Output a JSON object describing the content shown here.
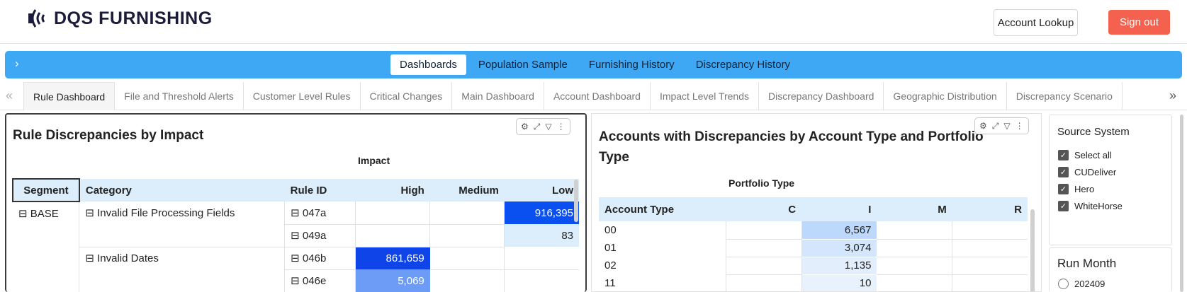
{
  "brand": {
    "name": "DQS FURNISHING"
  },
  "header": {
    "lookup_label": "Account Lookup",
    "signout_label": "Sign out"
  },
  "nav": {
    "items": [
      {
        "label": "Dashboards",
        "active": true
      },
      {
        "label": "Population Sample",
        "active": false
      },
      {
        "label": "Furnishing History",
        "active": false
      },
      {
        "label": "Discrepancy History",
        "active": false
      }
    ]
  },
  "tabs": [
    "Rule Dashboard",
    "File and Threshold Alerts",
    "Customer Level Rules",
    "Critical Changes",
    "Main Dashboard",
    "Account Dashboard",
    "Impact Level Trends",
    "Discrepancy Dashboard",
    "Geographic Distribution",
    "Discrepancy Scenario"
  ],
  "rule_panel": {
    "title": "Rule Discrepancies by Impact",
    "column_group": "Impact",
    "headers": [
      "Segment",
      "Category",
      "Rule ID",
      "High",
      "Medium",
      "Low"
    ],
    "segment": "BASE",
    "categories": [
      "Invalid File Processing Fields",
      "Invalid Dates"
    ],
    "rules": [
      {
        "id": "047a",
        "high": "",
        "medium": "",
        "low": "916,395"
      },
      {
        "id": "049a",
        "high": "",
        "medium": "",
        "low": "83"
      },
      {
        "id": "046b",
        "high": "861,659",
        "medium": "",
        "low": ""
      },
      {
        "id": "046e",
        "high": "5,069",
        "medium": "",
        "low": ""
      }
    ]
  },
  "account_panel": {
    "title": "Accounts with Discrepancies by Account Type and Portfolio Type",
    "column_group": "Portfolio Type",
    "headers": [
      "Account Type",
      "C",
      "I",
      "M",
      "R"
    ],
    "rows": [
      {
        "type": "00",
        "C": "",
        "I": "6,567",
        "M": "",
        "R": ""
      },
      {
        "type": "01",
        "C": "",
        "I": "3,074",
        "M": "",
        "R": ""
      },
      {
        "type": "02",
        "C": "",
        "I": "1,135",
        "M": "",
        "R": ""
      },
      {
        "type": "11",
        "C": "",
        "I": "10",
        "M": "",
        "R": ""
      }
    ]
  },
  "source_slicer": {
    "title": "Source System",
    "options": [
      "Select all",
      "CUDeliver",
      "Hero",
      "WhiteHorse"
    ]
  },
  "run_month_slicer": {
    "title": "Run Month",
    "options": [
      "202409"
    ]
  },
  "colors": {
    "nav_blue": "#3ea8f4",
    "signout_red": "#f4624f",
    "cell_dark": "#0a4ff0",
    "cell_mid": "#6d9cf7",
    "cell_light": "#dceefb",
    "cell_accent": "#0f44e8"
  }
}
